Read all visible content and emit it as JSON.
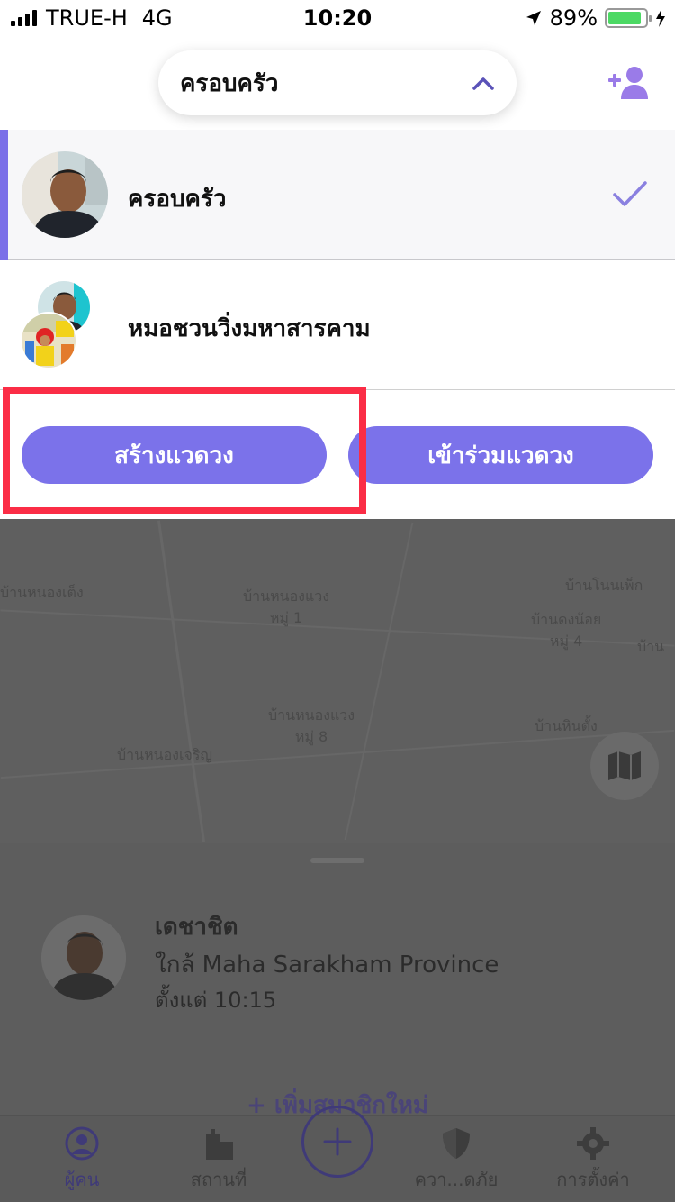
{
  "status_bar": {
    "carrier": "TRUE-H",
    "network": "4G",
    "time": "10:20",
    "battery_percent": "89%",
    "battery_level": 0.89,
    "icons": [
      "signal-icon",
      "location-arrow-icon",
      "battery-icon",
      "charging-icon"
    ]
  },
  "header": {
    "selected_circle": "ครอบครัว",
    "chevron_icon": "chevron-up-icon",
    "add_member_icon": "add-person-icon"
  },
  "circles": [
    {
      "name": "ครอบครัว",
      "selected": true
    },
    {
      "name": "หมอชวนวิ่งมหาสารคาม",
      "selected": false
    }
  ],
  "actions": {
    "create_label": "สร้างแวดวง",
    "join_label": "เข้าร่วมแวดวง"
  },
  "map": {
    "labels": [
      "บ้านหนองเต็ง",
      "บ้านหนองแวง",
      "หมู่ 1",
      "บ้านโนนเพ็ก",
      "บ้านดงน้อย",
      "หมู่ 4",
      "บ้าน",
      "บ้านหนองแวง",
      "หมู่ 8",
      "บ้านหินตั้ง",
      "บ้านหนองเจริญ"
    ],
    "toggle_icon": "map-icon"
  },
  "member_card": {
    "name": "เดชาชิต",
    "location": "ใกล้ Maha Sarakham Province",
    "since": "ตั้งแต่ 10:15",
    "add_member_link": "+ เพิ่มสมาชิกใหม่"
  },
  "tab_bar": {
    "tabs": [
      {
        "label": "ผู้คน",
        "icon": "person-icon",
        "active": true
      },
      {
        "label": "สถานที่",
        "icon": "building-icon",
        "active": false
      },
      {
        "label": "ควา...ดภัย",
        "icon": "shield-icon",
        "active": false
      },
      {
        "label": "การตั้งค่า",
        "icon": "gear-icon",
        "active": false
      }
    ],
    "center_icon": "plus-icon"
  },
  "colors": {
    "accent": "#7b72ea",
    "highlight": "#fb2d46",
    "check": "#8a80e0"
  }
}
